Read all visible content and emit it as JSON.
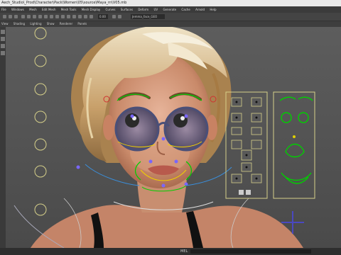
{
  "titlebar": {
    "text": "Aech_Studio\\_Prod\\Character\\Pack\\Women\\05\\source\\Maya_rn\\V05.mb"
  },
  "menubar": {
    "items": [
      "File",
      "Windows",
      "Mesh",
      "Edit Mesh",
      "Mesh Tools",
      "Mesh Display",
      "Curves",
      "Surfaces",
      "Deform",
      "UV",
      "Generate",
      "Cache",
      "Arnold",
      "Help"
    ]
  },
  "toolbar": {
    "field_value": "0.00",
    "object_field": "Jemma_face_GEO"
  },
  "panel": {
    "menu_items": [
      "View",
      "Shading",
      "Lighting",
      "Show",
      "Renderer",
      "Panels"
    ]
  },
  "statusbar": {
    "label": "MEL"
  }
}
